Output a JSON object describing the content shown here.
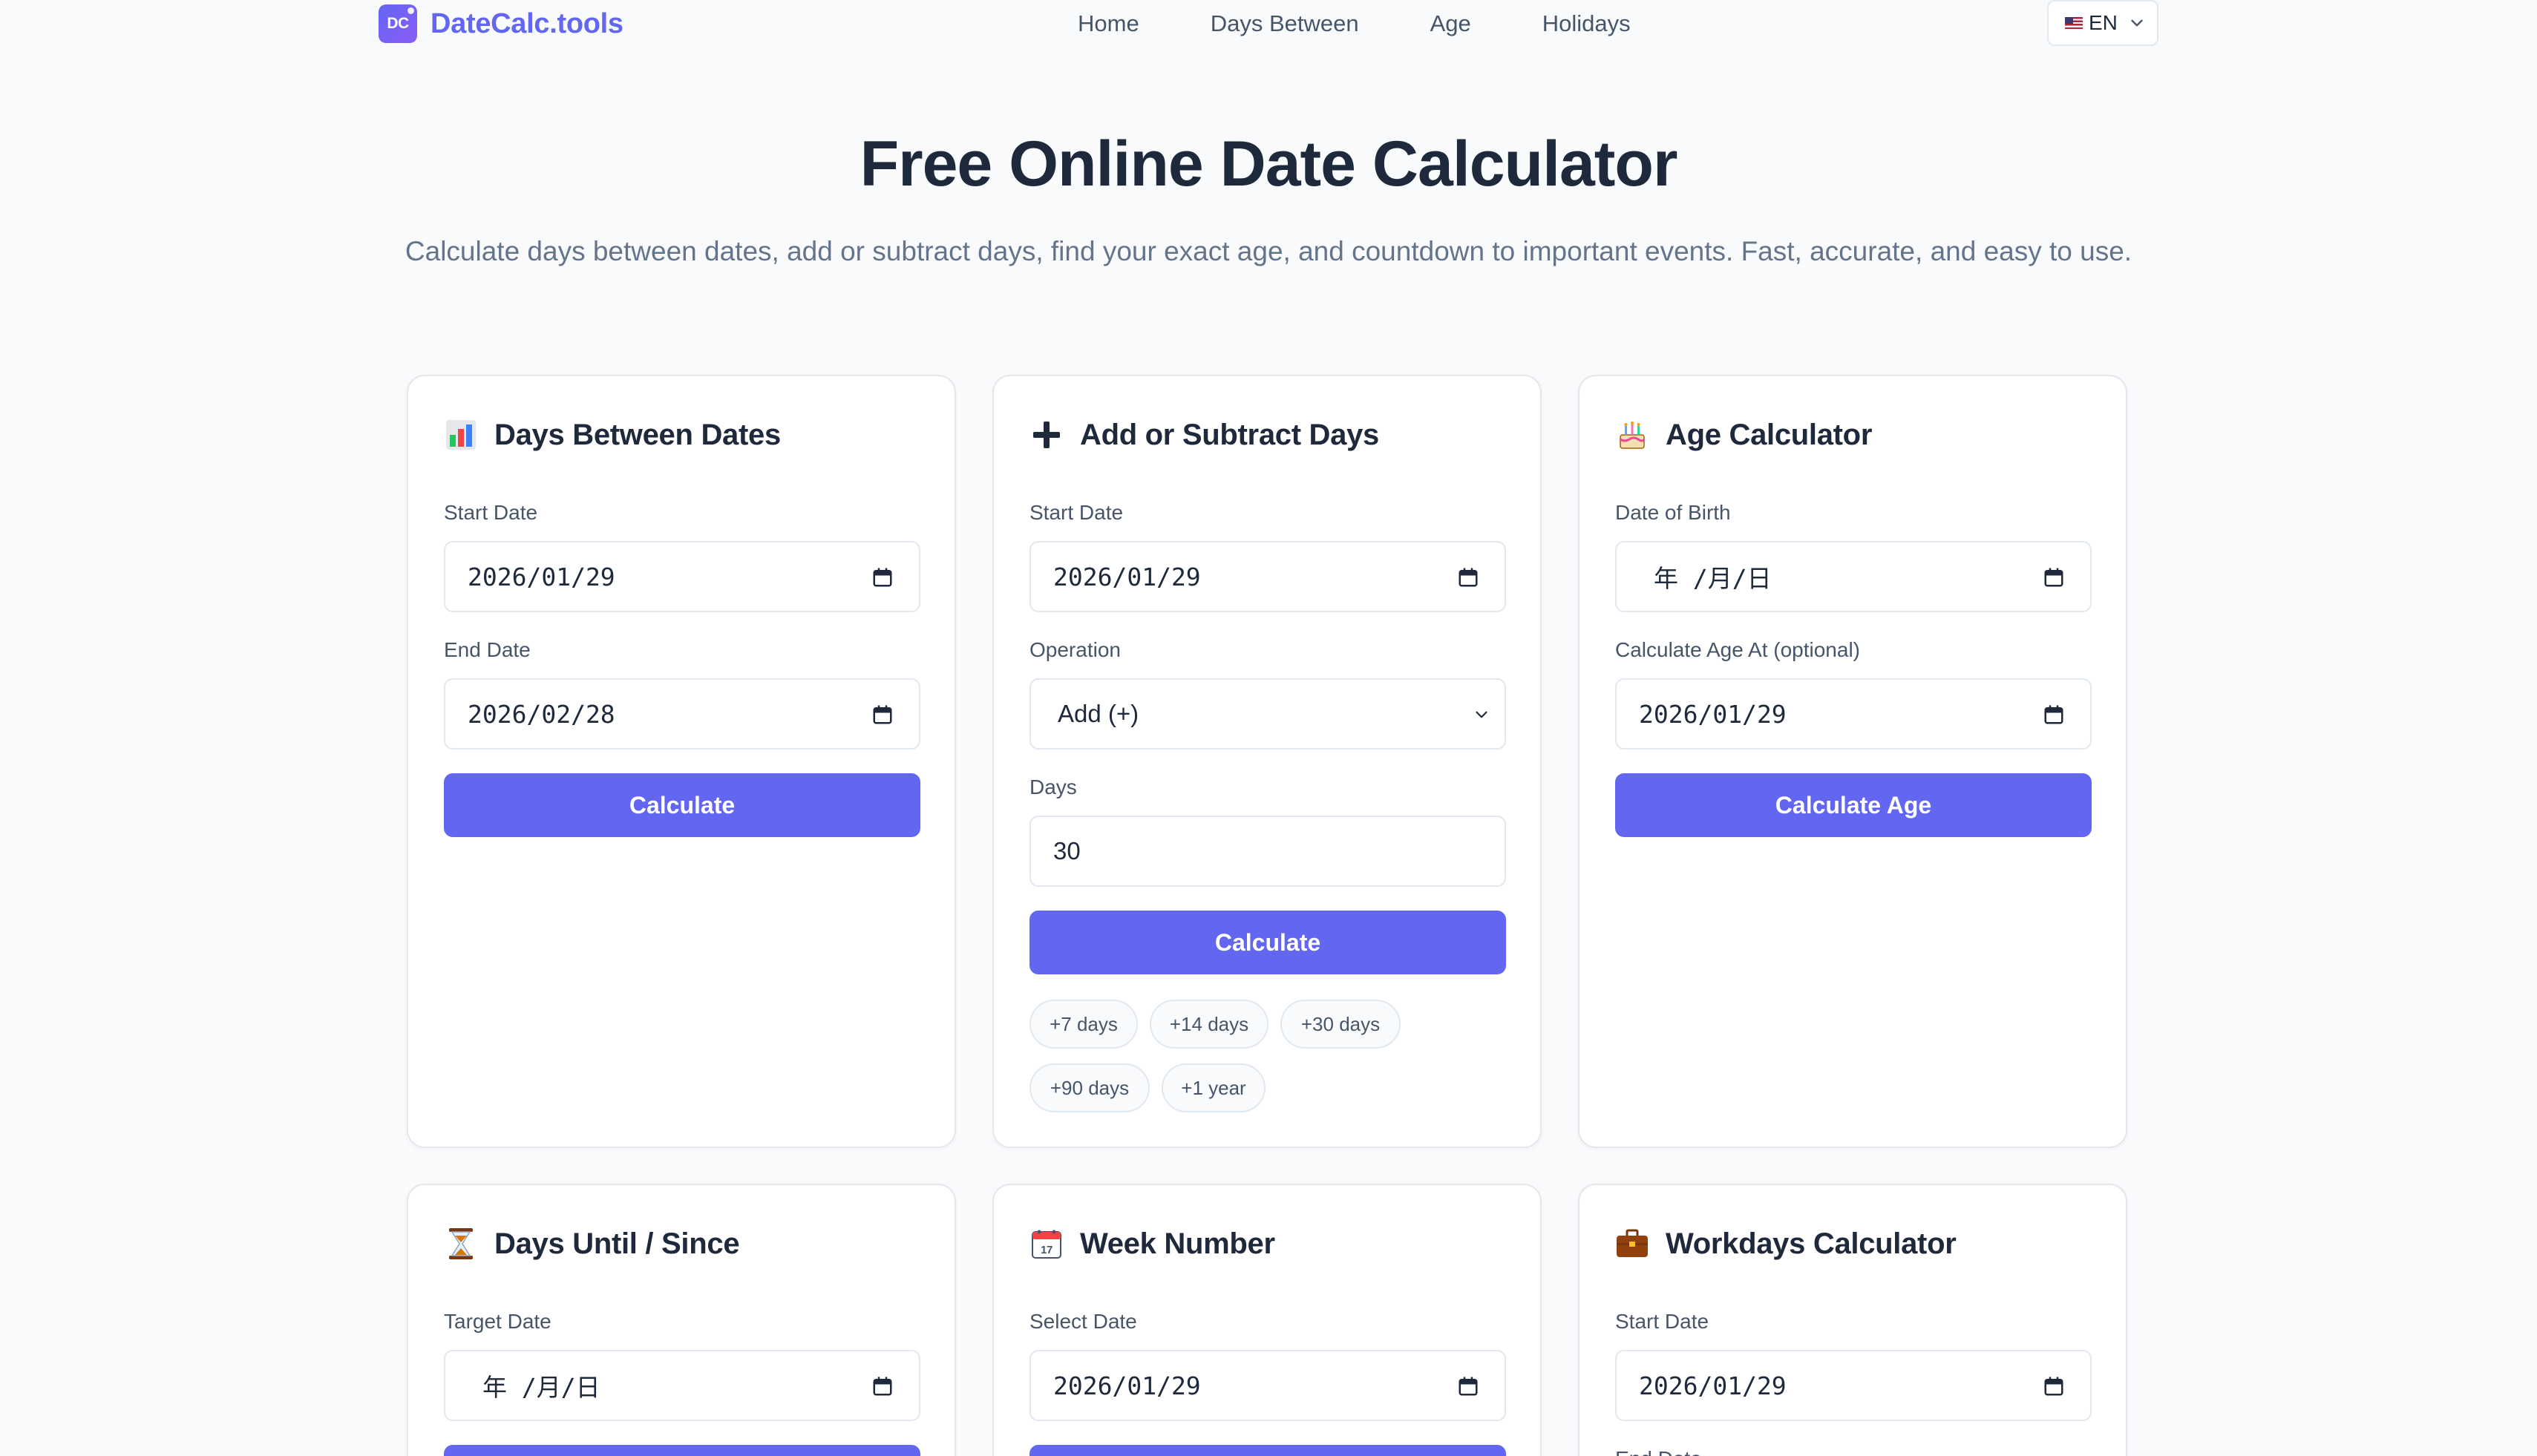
{
  "header": {
    "logo_mark": "DC",
    "logo_text": "DateCalc.tools",
    "nav": [
      "Home",
      "Days Between",
      "Age",
      "Holidays"
    ],
    "lang_label": "EN"
  },
  "hero": {
    "title": "Free Online Date Calculator",
    "subtitle": "Calculate days between dates, add or subtract days, find your exact age, and countdown to important events. Fast, accurate, and easy to use."
  },
  "cards": {
    "days_between": {
      "title": "Days Between Dates",
      "icon": "bar-chart-icon",
      "start_label": "Start Date",
      "start_value": "2026/01/29",
      "end_label": "End Date",
      "end_value": "2026/02/28",
      "button": "Calculate"
    },
    "add_subtract": {
      "title": "Add or Subtract Days",
      "icon": "plus-icon",
      "start_label": "Start Date",
      "start_value": "2026/01/29",
      "operation_label": "Operation",
      "operation_value": "Add (+)",
      "days_label": "Days",
      "days_value": "30",
      "button": "Calculate",
      "chips": [
        "+7 days",
        "+14 days",
        "+30 days",
        "+90 days",
        "+1 year"
      ]
    },
    "age": {
      "title": "Age Calculator",
      "icon": "birthday-cake-icon",
      "dob_label": "Date of Birth",
      "dob_value": "年 /月/日",
      "at_label": "Calculate Age At (optional)",
      "at_value": "2026/01/29",
      "button": "Calculate Age"
    },
    "until_since": {
      "title": "Days Until / Since",
      "icon": "hourglass-icon",
      "target_label": "Target Date",
      "target_value": "年 /月/日"
    },
    "week_number": {
      "title": "Week Number",
      "icon": "calendar-icon",
      "select_label": "Select Date",
      "select_value": "2026/01/29"
    },
    "workdays": {
      "title": "Workdays Calculator",
      "icon": "briefcase-icon",
      "start_label": "Start Date",
      "start_value": "2026/01/29",
      "end_label": "End Date"
    }
  },
  "colors": {
    "accent": "#6366f1",
    "background": "#f8fafc",
    "card_border": "#e5e7eb"
  }
}
